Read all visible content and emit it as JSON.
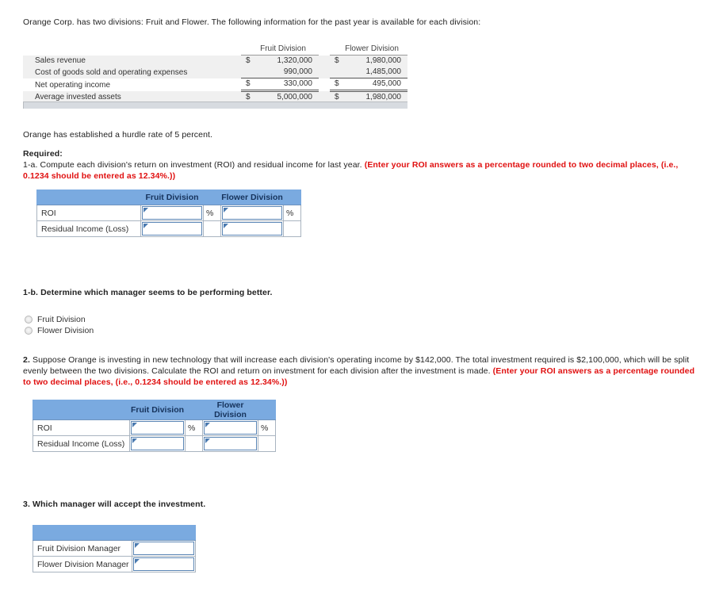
{
  "intro": "Orange Corp. has two divisions: Fruit and Flower. The following information for the past year is available for each division:",
  "given_table": {
    "columns": [
      "",
      "Fruit Division",
      "Flower Division"
    ],
    "currency_symbol": "$",
    "rows": [
      {
        "label": "Sales revenue",
        "fruit": "1,320,000",
        "flower": "1,980,000",
        "fruit_cur": "$",
        "flower_cur": "$"
      },
      {
        "label": "Cost of goods sold and operating expenses",
        "fruit": "990,000",
        "flower": "1,485,000",
        "fruit_cur": "",
        "flower_cur": ""
      },
      {
        "label": "Net operating income",
        "fruit": "330,000",
        "flower": "495,000",
        "fruit_cur": "$",
        "flower_cur": "$"
      },
      {
        "label": "Average invested assets",
        "fruit": "5,000,000",
        "flower": "1,980,000",
        "fruit_cur": "$",
        "flower_cur": "$"
      }
    ]
  },
  "hurdle_text": "Orange has established a hurdle rate of 5 percent.",
  "required_label": "Required:",
  "q1a": {
    "prefix": "1-a. Compute each division's return on investment (ROI) and residual income for last year. ",
    "red": "(Enter your ROI answers as a percentage rounded to two decimal places, (i.e., 0.1234 should be entered as 12.34%.))"
  },
  "answer_table_1": {
    "headers": [
      "",
      "Fruit Division",
      "Flower Division"
    ],
    "rows": [
      {
        "label": "ROI",
        "fruit_value": "",
        "fruit_suffix": "%",
        "flower_value": "",
        "flower_suffix": "%"
      },
      {
        "label": "Residual Income (Loss)",
        "fruit_value": "",
        "fruit_suffix": "",
        "flower_value": "",
        "flower_suffix": ""
      }
    ]
  },
  "q1b": {
    "number": "1-b.",
    "text": " Determine which manager seems to be performing better."
  },
  "radio_options": [
    {
      "label": "Fruit Division",
      "selected": false
    },
    {
      "label": "Flower Division",
      "selected": false
    }
  ],
  "q2": {
    "number": "2.",
    "black": " Suppose Orange is investing in new technology that will increase each division's operating income by $142,000. The total investment required is $2,100,000, which will be split evenly between the two divisions. Calculate the ROI and return on investment for each division after the investment is made. ",
    "red": "(Enter your ROI answers as a percentage rounded to two decimal places, (i.e., 0.1234 should be entered as 12.34%.))"
  },
  "answer_table_2": {
    "headers": [
      "",
      "Fruit Division",
      "Flower Division"
    ],
    "rows": [
      {
        "label": "ROI",
        "fruit_value": "",
        "fruit_suffix": "%",
        "flower_value": "",
        "flower_suffix": "%"
      },
      {
        "label": "Residual Income (Loss)",
        "fruit_value": "",
        "fruit_suffix": "",
        "flower_value": "",
        "flower_suffix": ""
      }
    ]
  },
  "q3": {
    "number": "3.",
    "text": " Which manager will accept the investment."
  },
  "answer_table_3": {
    "headers": [
      "",
      ""
    ],
    "rows": [
      {
        "label": "Fruit Division Manager",
        "value": ""
      },
      {
        "label": "Flower Division Manager",
        "value": ""
      }
    ]
  },
  "colors": {
    "header_blue": "#7aaae0",
    "input_border": "#5b86b5",
    "red_text": "#e01010",
    "row_shade": "#f0f0f0",
    "footer_bar": "#d7dbe0"
  }
}
